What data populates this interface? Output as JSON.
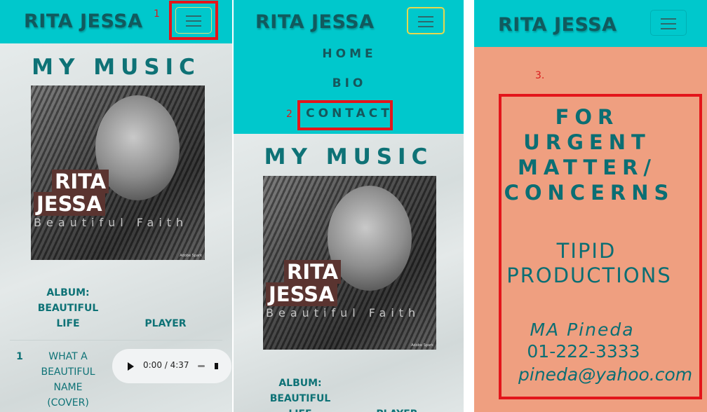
{
  "brand": "RITA JESSA",
  "annotations": [
    "1",
    "2",
    "3."
  ],
  "music": {
    "heading": "MY MUSIC",
    "cover_name_line1": "RITA",
    "cover_name_line2": "JESSA",
    "cover_subtitle": "Beautiful Faith",
    "cover_stamp": "Adobe Spark",
    "album_header_lines": [
      "ALBUM:",
      "BEAUTIFUL",
      "LIFE"
    ],
    "player_header": "PLAYER",
    "tracks": [
      {
        "number": "1",
        "title_lines": [
          "WHAT A",
          "BEAUTIFUL",
          "NAME",
          "(COVER)"
        ],
        "time": "0:00 / 4:37"
      }
    ]
  },
  "menu": {
    "items": [
      "HOME",
      "BIO",
      "CONTACT"
    ]
  },
  "contact": {
    "heading_lines": [
      "FOR",
      "URGENT",
      "MATTER/",
      "CONCERNS"
    ],
    "company_lines": [
      "TIPID",
      "PRODUCTIONS"
    ],
    "person": "MA Pineda",
    "phone": "01-222-3333",
    "email": "pineda@yahoo.com"
  },
  "colors": {
    "header": "#00c8cc",
    "teal_text": "#0e7276",
    "contact_bg": "#ef9f80",
    "highlight": "#e3151b"
  }
}
